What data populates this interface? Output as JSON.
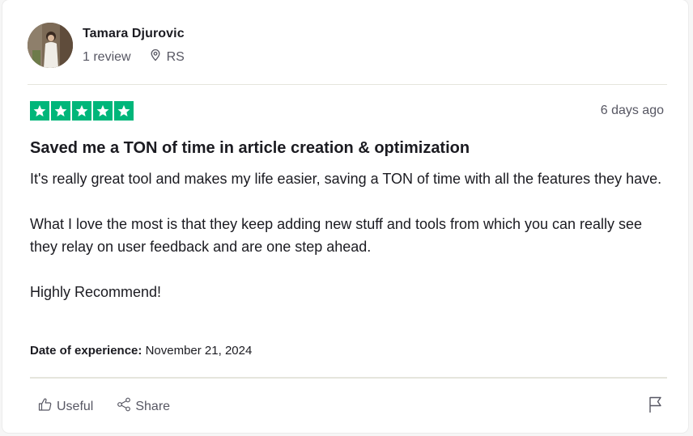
{
  "reviewer": {
    "name": "Tamara Djurovic",
    "reviews": "1 review",
    "country": "RS"
  },
  "review": {
    "rating": 5,
    "rating_max": 5,
    "date": "6 days ago",
    "title": "Saved me a TON of time in article creation & optimization",
    "paragraphs": [
      "It's really great tool and makes my life easier, saving a TON of time with all the features they have.",
      "What I love the most is that they keep adding new stuff and tools from which you can really see they relay on user feedback and are one step ahead.",
      "Highly Recommend!"
    ],
    "experience_label": "Date of experience:",
    "experience_date": "November 21, 2024"
  },
  "actions": {
    "useful": "Useful",
    "share": "Share"
  },
  "icons": {
    "location": "location-pin-icon",
    "useful": "thumbs-up-icon",
    "share": "share-icon",
    "flag": "flag-icon"
  },
  "colors": {
    "star_green": "#00b67a",
    "text_dark": "#1b1b21",
    "text_muted": "#575763"
  }
}
